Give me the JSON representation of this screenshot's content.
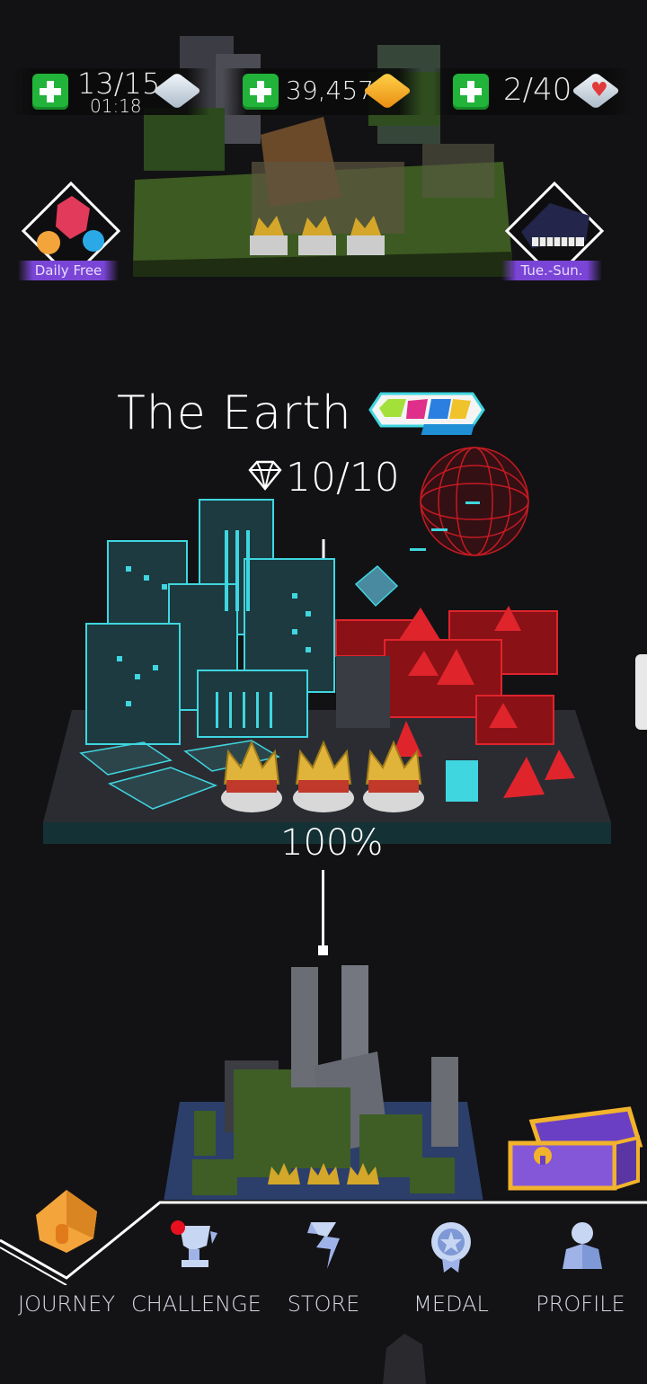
{
  "resources": {
    "energy": {
      "value": "13/15",
      "timer": "01:18",
      "icon": "ice-cube-icon",
      "color": "#d9e4ee"
    },
    "coins": {
      "value": "39,457",
      "icon": "gold-cube-icon",
      "color": "#f2a81d"
    },
    "hearts": {
      "value": "2/40",
      "icon": "heart-cube-icon",
      "color": "#e23a3a"
    }
  },
  "side_buttons": {
    "daily_free": {
      "label": "Daily Free",
      "icon": "balloon-gems-icon"
    },
    "weekly": {
      "label": "Tue.-Sun.",
      "icon": "grand-piano-icon"
    }
  },
  "level": {
    "title": "The Earth",
    "badge": "color-remix-badge",
    "gems": "10/10",
    "progress": "100%",
    "progress_value": 1.0,
    "crowns": 3
  },
  "nav": {
    "items": [
      {
        "label": "JOURNEY",
        "icon": "house-icon",
        "active": true
      },
      {
        "label": "CHALLENGE",
        "icon": "trophy-icon",
        "notification": true
      },
      {
        "label": "STORE",
        "icon": "store-s-icon"
      },
      {
        "label": "MEDAL",
        "icon": "medal-icon"
      },
      {
        "label": "PROFILE",
        "icon": "profile-icon"
      }
    ]
  },
  "colors": {
    "accent_cyan": "#3fd6e0",
    "accent_red": "#e0242c",
    "nav_icon": "#9fb3e8"
  }
}
